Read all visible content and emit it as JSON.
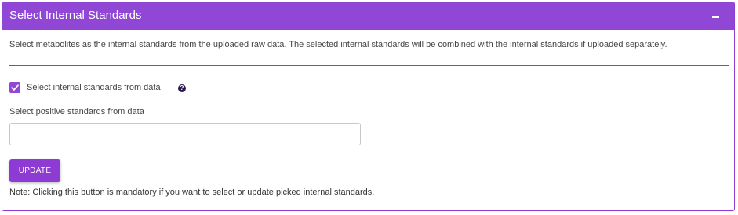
{
  "panel": {
    "title": "Select Internal Standards",
    "collapse_icon": "minus-icon",
    "description": "Select metabolites as the internal standards from the uploaded raw data. The selected internal standards will be combined with the internal standards if uploaded separately."
  },
  "checkbox": {
    "label": "Select internal standards from data",
    "checked": true,
    "help_icon": "question-circle-icon",
    "help_glyph": "?"
  },
  "positive_standards": {
    "label": "Select positive standards from data",
    "value": ""
  },
  "update_button": {
    "label": "UPDATE"
  },
  "note": "Note: Clicking this button is mandatory if you want to select or update picked internal standards.",
  "colors": {
    "accent": "#9047d6",
    "header_bg": "#9047d6",
    "button_bg": "#8e3bd3"
  }
}
